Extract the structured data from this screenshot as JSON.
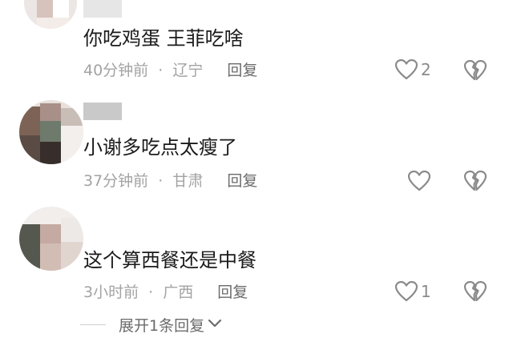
{
  "colors": {
    "text": "#1a1a1a",
    "meta": "#a3a3a3",
    "reply": "#6b6b6b",
    "icon": "#8a8a8a"
  },
  "comments": [
    {
      "text": "你吃鸡蛋 王菲吃啥",
      "time": "40分钟前",
      "location": "辽宁",
      "reply_label": "回复",
      "like_count": "2",
      "like_icon": "heart-outline",
      "dislike_icon": "broken-heart"
    },
    {
      "text": "小谢多吃点太瘦了",
      "time": "37分钟前",
      "location": "甘肃",
      "reply_label": "回复",
      "like_count": "",
      "like_icon": "heart-outline",
      "dislike_icon": "broken-heart"
    },
    {
      "text": "这个算西餐还是中餐",
      "time": "3小时前",
      "location": "广西",
      "reply_label": "回复",
      "like_count": "1",
      "like_icon": "heart-outline",
      "dislike_icon": "broken-heart"
    }
  ],
  "separator": "·",
  "expand_replies": {
    "label": "展开1条回复",
    "icon": "chevron-down"
  }
}
